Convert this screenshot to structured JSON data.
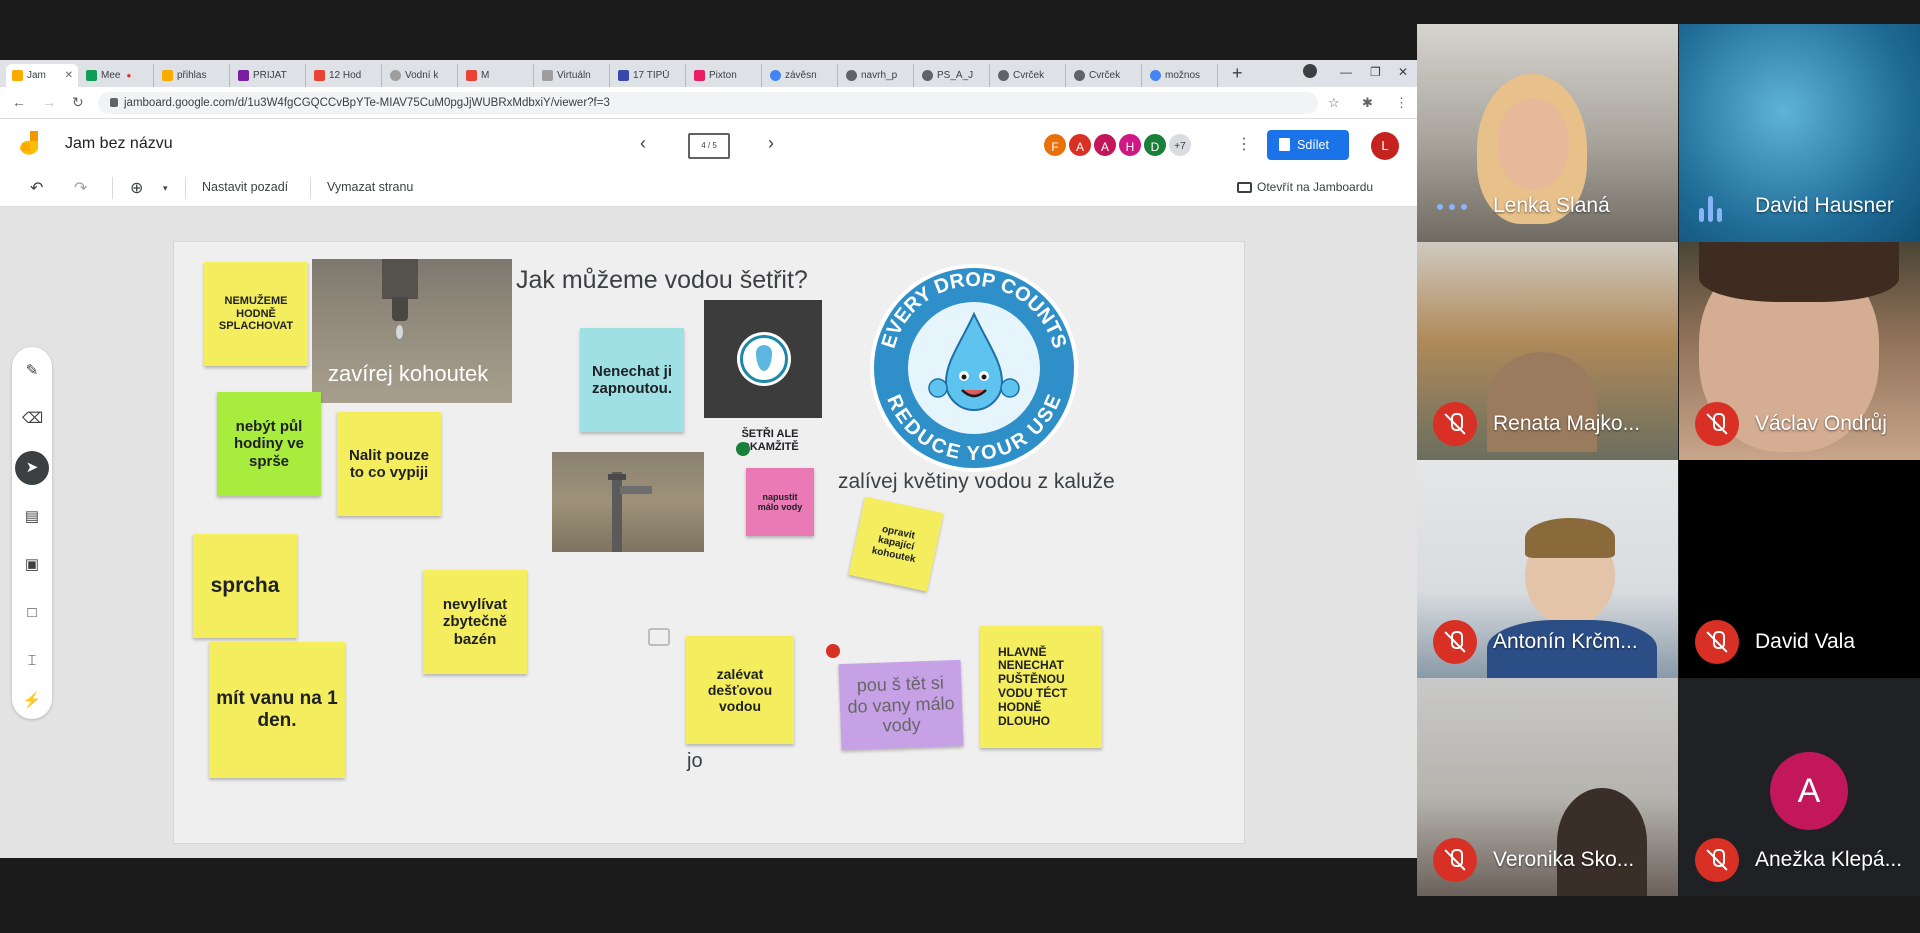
{
  "browser": {
    "tabs": [
      {
        "label": "Jam",
        "color": "#f9ab00",
        "active": true
      },
      {
        "label": "Mee",
        "color": "#0f9d58"
      },
      {
        "label": "přihlas",
        "color": "#f9ab00"
      },
      {
        "label": "PŘIJAT",
        "color": "#7b1fa2"
      },
      {
        "label": "12 Hod",
        "color": "#ea4335"
      },
      {
        "label": "Vodní k",
        "color": "#9e9e9e"
      },
      {
        "label": "M",
        "color": "#ea4335"
      },
      {
        "label": "Virtuáln",
        "color": "#9e9e9e"
      },
      {
        "label": "17 TIPŮ",
        "color": "#3949ab"
      },
      {
        "label": "Pixton",
        "color": "#e91e63"
      },
      {
        "label": "závěsn",
        "color": "#4285f4"
      },
      {
        "label": "navrh_p",
        "color": "#5f6368"
      },
      {
        "label": "PS_Á_J",
        "color": "#5f6368"
      },
      {
        "label": "Cvrček",
        "color": "#5f6368"
      },
      {
        "label": "Cvrček",
        "color": "#5f6368"
      },
      {
        "label": "možnos",
        "color": "#4285f4"
      }
    ],
    "new_tab": "+",
    "url": "jamboard.google.com/d/1u3W4fgCGQCCvBpYTe-MIAV75CuM0pgJjWUBRxMdbxiY/viewer?f=3"
  },
  "jam": {
    "title": "Jam bez názvu",
    "frame_indicator": "4 / 5",
    "avatars": [
      {
        "letter": "F",
        "color": "#e8710a"
      },
      {
        "letter": "A",
        "color": "#d93025"
      },
      {
        "letter": "A",
        "color": "#c2185b"
      },
      {
        "letter": "H",
        "color": "#d01884"
      },
      {
        "letter": "D",
        "color": "#188038"
      },
      {
        "letter": "+7",
        "color": "#dadce0"
      }
    ],
    "share_label": "Sdílet",
    "profile_letter": "L",
    "toolbar": {
      "set_background": "Nastavit pozadí",
      "clear_page": "Vymazat stranu",
      "open_on_jamboard": "Otevřít na Jamboardu"
    }
  },
  "board": {
    "heading": "Jak můžeme vodou šetřit?",
    "faucet_caption": "zavírej kohoutek",
    "badge_top": "EVERY DROP COUNTS",
    "badge_bottom": "REDUCE YOUR USE",
    "text_save": "ŠETŘI ALE OKAMŽITĚ",
    "text_flowers": "zalívej květiny vodou z kaluže",
    "text_jo": "jo",
    "notes": {
      "n1": "NEMUŽEME HODNĚ SPLACHOVAT",
      "n2": "nebýt půl hodiny ve sprše",
      "n3": "Nalit pouze to co vypiji",
      "n4": "Nenechat ji zapnoutou.",
      "n5": "napustit málo vody",
      "n6": "opravit kapající kohoutek",
      "n7": "sprcha",
      "n8": "nevylívat zbytečně bazén",
      "n9": "mít vanu na 1 den.",
      "n10": "zalévat dešťovou vodou",
      "n11": "pou š tět si do vany málo vody",
      "n12": "HLAVNĚ NENECHAT PUŠTĚNOU VODU TÉCT HODNĚ DLOUHO"
    }
  },
  "participants": [
    {
      "name": "Lenka Slaná",
      "muted": false,
      "status": "dots"
    },
    {
      "name": "David Hausner",
      "muted": false,
      "status": "wave"
    },
    {
      "name": "Renata Majko...",
      "muted": true
    },
    {
      "name": "Václav Ondrůj",
      "muted": true
    },
    {
      "name": "Antonín Krčm...",
      "muted": true
    },
    {
      "name": "David Vala",
      "muted": true
    },
    {
      "name": "Veronika Sko...",
      "muted": true
    },
    {
      "name": "Anežka Klepá...",
      "muted": true,
      "avatar_letter": "A"
    }
  ]
}
